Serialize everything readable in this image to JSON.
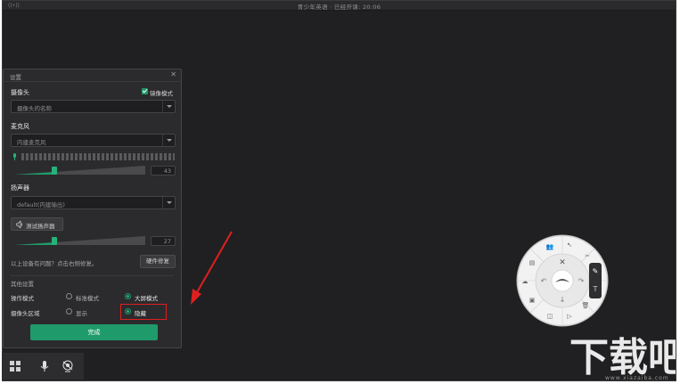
{
  "app": {
    "title": "青少年英语 · 已经开课: 20:06"
  },
  "dialog": {
    "title": "设置",
    "camera": {
      "label": "摄像头",
      "mirror_label": "镜像模式",
      "value": "摄像头的名称"
    },
    "microphone": {
      "label": "麦克风",
      "value": "内建麦克风",
      "volume": "43",
      "volume_level": 0.3
    },
    "speaker": {
      "label": "扬声器",
      "value": "default(内建输出)",
      "test_label": "测试扬声器",
      "volume": "27",
      "volume_level": 0.3
    },
    "hint": "以上设备有问题？点击右侧修复。",
    "repair_label": "硬件修复",
    "other": {
      "title": "其他设置",
      "mode": {
        "label": "操作模式",
        "options": [
          "标准模式",
          "大屏模式"
        ],
        "selected": "大屏模式"
      },
      "camera_area": {
        "label": "摄像头区域",
        "options": [
          "显示",
          "隐藏"
        ],
        "selected": "隐藏"
      }
    },
    "done_label": "完成"
  },
  "watermark": {
    "text": "下载吧",
    "sub": "www.xiazaiba.com"
  },
  "colors": {
    "accent": "#1f9a6a",
    "highlight": "#e01f1f",
    "background": "#202022"
  },
  "icons": [
    "close-icon",
    "mic-icon",
    "speaker-icon",
    "grid-icon",
    "camera-icon",
    "pen-icon",
    "eraser-icon",
    "text-icon"
  ]
}
